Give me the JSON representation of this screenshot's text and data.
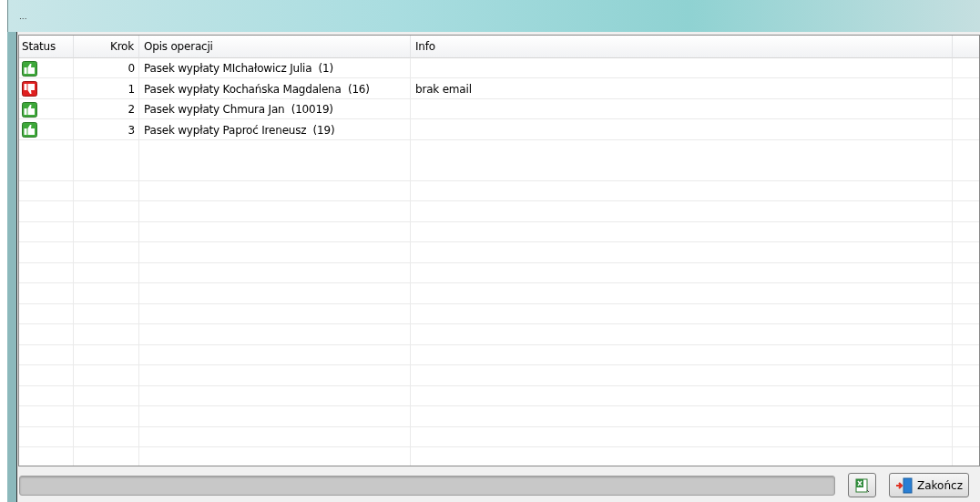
{
  "window": {
    "title": "..."
  },
  "table": {
    "columns": [
      "Status",
      "Krok",
      "Opis operacji",
      "Info"
    ],
    "rows": [
      {
        "kind": "ok",
        "krok": "0",
        "opis": "Pasek wypłaty MIchałowicz Julia  (1)",
        "info": ""
      },
      {
        "kind": "error",
        "krok": "1",
        "opis": "Pasek wypłaty Kochańska Magdalena  (16)",
        "info": "brak email"
      },
      {
        "kind": "ok",
        "krok": "2",
        "opis": "Pasek wypłaty Chmura Jan  (10019)",
        "info": ""
      },
      {
        "kind": "ok",
        "krok": "3",
        "opis": "Pasek wypłaty Paproć Ireneusz  (19)",
        "info": ""
      }
    ]
  },
  "buttons": [
    {
      "kind": "excel"
    },
    {
      "kind": "exit",
      "label": "Zakończ"
    }
  ]
}
